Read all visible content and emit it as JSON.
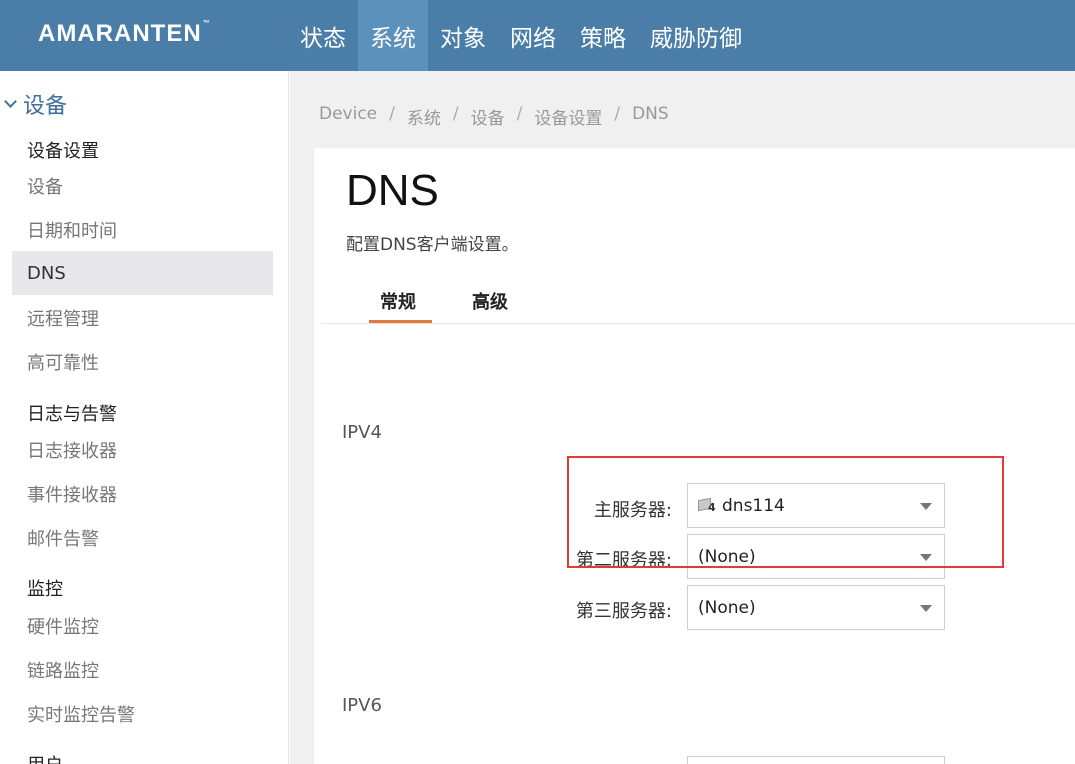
{
  "header": {
    "logo": "AMARANTEN",
    "trademark": "™",
    "nav": [
      "状态",
      "系统",
      "对象",
      "网络",
      "策略",
      "威胁防御"
    ],
    "active_nav": "系统"
  },
  "sidebar": {
    "title": "设备",
    "group_device_settings": "设备设置",
    "item_device": "设备",
    "item_datetime": "日期和时间",
    "item_dns": "DNS",
    "item_remote": "远程管理",
    "item_ha": "高可靠性",
    "group_logs": "日志与告警",
    "item_log_receiver": "日志接收器",
    "item_event_receiver": "事件接收器",
    "item_mail_alert": "邮件告警",
    "group_monitor": "监控",
    "item_hw_monitor": "硬件监控",
    "item_link_monitor": "链路监控",
    "item_rt_alert": "实时监控告警",
    "group_user": "用户"
  },
  "breadcrumb": [
    "Device",
    "系统",
    "设备",
    "设备设置",
    "DNS"
  ],
  "breadcrumb_sep": "/",
  "page": {
    "title": "DNS",
    "description": "配置DNS客户端设置。",
    "tabs": [
      "常规",
      "高级"
    ],
    "active_tab": "常规"
  },
  "ipv4": {
    "label": "IPV4",
    "primary_label": "主服务器:",
    "primary_value": "dns114",
    "primary_icon_badge": "4",
    "secondary_label": "第二服务器:",
    "secondary_value": "(None)",
    "tertiary_label": "第三服务器:",
    "tertiary_value": "(None)"
  },
  "ipv6": {
    "label": "IPV6"
  },
  "colors": {
    "topbar": "#4a7ea8",
    "nav_active": "#5b91bb",
    "tab_underline": "#e07a3a",
    "highlight_box": "#e53935"
  }
}
